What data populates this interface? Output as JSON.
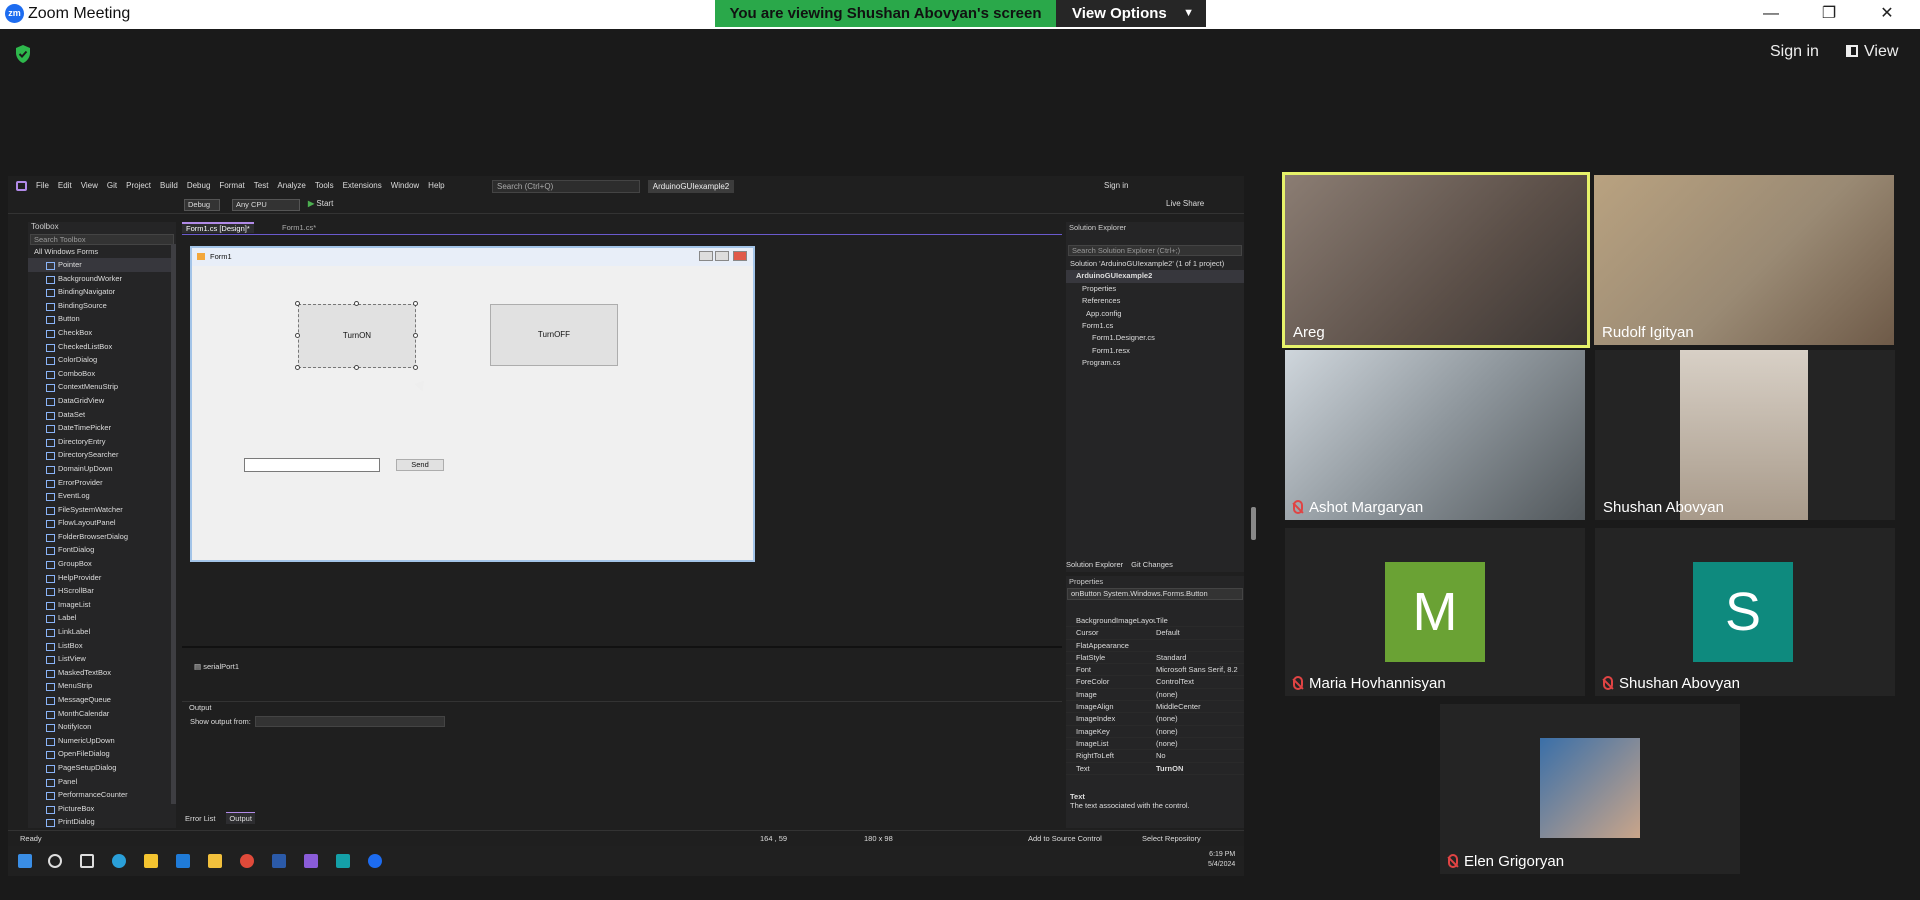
{
  "zoom": {
    "app_title": "Zoom Meeting",
    "logo_text": "zm",
    "share_banner": "You are viewing Shushan Abovyan's screen",
    "view_options": "View Options",
    "sign_in": "Sign in",
    "view": "View",
    "win_min": "—",
    "win_restore": "❐",
    "win_close": "✕"
  },
  "vs": {
    "menus": [
      "File",
      "Edit",
      "View",
      "Git",
      "Project",
      "Build",
      "Debug",
      "Format",
      "Test",
      "Analyze",
      "Tools",
      "Extensions",
      "Window",
      "Help"
    ],
    "search_placeholder": "Search (Ctrl+Q)",
    "project_name": "ArduinoGUIexample2",
    "sign_in": "Sign in",
    "toolbar": {
      "config": "Debug",
      "platform": "Any CPU",
      "start": "Start",
      "live_share": "Live Share"
    },
    "toolbox": {
      "title": "Toolbox",
      "search": "Search Toolbox",
      "category": "All Windows Forms",
      "items": [
        "Pointer",
        "BackgroundWorker",
        "BindingNavigator",
        "BindingSource",
        "Button",
        "CheckBox",
        "CheckedListBox",
        "ColorDialog",
        "ComboBox",
        "ContextMenuStrip",
        "DataGridView",
        "DataSet",
        "DateTimePicker",
        "DirectoryEntry",
        "DirectorySearcher",
        "DomainUpDown",
        "ErrorProvider",
        "EventLog",
        "FileSystemWatcher",
        "FlowLayoutPanel",
        "FolderBrowserDialog",
        "FontDialog",
        "GroupBox",
        "HelpProvider",
        "HScrollBar",
        "ImageList",
        "Label",
        "LinkLabel",
        "ListBox",
        "ListView",
        "MaskedTextBox",
        "MenuStrip",
        "MessageQueue",
        "MonthCalendar",
        "NotifyIcon",
        "NumericUpDown",
        "OpenFileDialog",
        "PageSetupDialog",
        "Panel",
        "PerformanceCounter",
        "PictureBox",
        "PrintDialog"
      ]
    },
    "tabs": {
      "design": "Form1.cs [Design]*",
      "code": "Form1.cs*"
    },
    "form": {
      "title": "Form1",
      "btn_on": "TurnON",
      "btn_off": "TurnOFF",
      "btn_send": "Send"
    },
    "tray_component": "serialPort1",
    "output": {
      "title": "Output",
      "show_from": "Show output from:"
    },
    "bottom_tabs": [
      "Error List",
      "Output"
    ],
    "solution_explorer": {
      "title": "Solution Explorer",
      "search": "Search Solution Explorer (Ctrl+;)",
      "items": [
        {
          "text": "Solution 'ArduinoGUIexample2' (1 of 1 project)",
          "bold": false
        },
        {
          "text": "ArduinoGUIexample2",
          "bold": true
        },
        {
          "text": "Properties",
          "bold": false
        },
        {
          "text": "References",
          "bold": false
        },
        {
          "text": "App.config",
          "bold": false
        },
        {
          "text": "Form1.cs",
          "bold": false
        },
        {
          "text": "Form1.Designer.cs",
          "bold": false
        },
        {
          "text": "Form1.resx",
          "bold": false
        },
        {
          "text": "Program.cs",
          "bold": false
        }
      ],
      "tabs": [
        "Solution Explorer",
        "Git Changes"
      ]
    },
    "properties": {
      "title": "Properties",
      "object": "onButton  System.Windows.Forms.Button",
      "rows": [
        {
          "name": "BackgroundImageLayout",
          "value": "Tile"
        },
        {
          "name": "Cursor",
          "value": "Default"
        },
        {
          "name": "FlatAppearance",
          "value": ""
        },
        {
          "name": "FlatStyle",
          "value": "Standard"
        },
        {
          "name": "Font",
          "value": "Microsoft Sans Serif, 8.2"
        },
        {
          "name": "ForeColor",
          "value": "ControlText"
        },
        {
          "name": "Image",
          "value": "(none)"
        },
        {
          "name": "ImageAlign",
          "value": "MiddleCenter"
        },
        {
          "name": "ImageIndex",
          "value": "(none)"
        },
        {
          "name": "ImageKey",
          "value": "(none)"
        },
        {
          "name": "ImageList",
          "value": "(none)"
        },
        {
          "name": "RightToLeft",
          "value": "No"
        },
        {
          "name": "Text",
          "value": "TurnON"
        }
      ],
      "desc_title": "Text",
      "desc_text": "The text associated with the control."
    },
    "status": {
      "ready": "Ready",
      "position": "164 , 59",
      "size": "180 x 98",
      "source_control": "Add to Source Control",
      "repository": "Select Repository"
    },
    "clock": {
      "time": "6:19 PM",
      "date": "5/4/2024"
    }
  },
  "participants": [
    {
      "name": "Areg",
      "muted": false,
      "active": true,
      "avatar": ""
    },
    {
      "name": "Rudolf Igityan",
      "muted": false,
      "active": false,
      "avatar": ""
    },
    {
      "name": "Ashot Margaryan",
      "muted": true,
      "active": false,
      "avatar": ""
    },
    {
      "name": "Shushan Abovyan",
      "muted": false,
      "active": false,
      "avatar": ""
    },
    {
      "name": "Maria Hovhannisyan",
      "muted": true,
      "active": false,
      "avatar": "M"
    },
    {
      "name": "Shushan Abovyan",
      "muted": true,
      "active": false,
      "avatar": "S"
    },
    {
      "name": "Elen Grigoryan",
      "muted": true,
      "active": false,
      "avatar": ""
    }
  ],
  "colors": {
    "share_green": "#2aa84a",
    "speaker_highlight": "#e6f26a",
    "avatar_m": "#6aa234",
    "avatar_s": "#0e8a7e",
    "vs_accent": "#b18ae8"
  }
}
